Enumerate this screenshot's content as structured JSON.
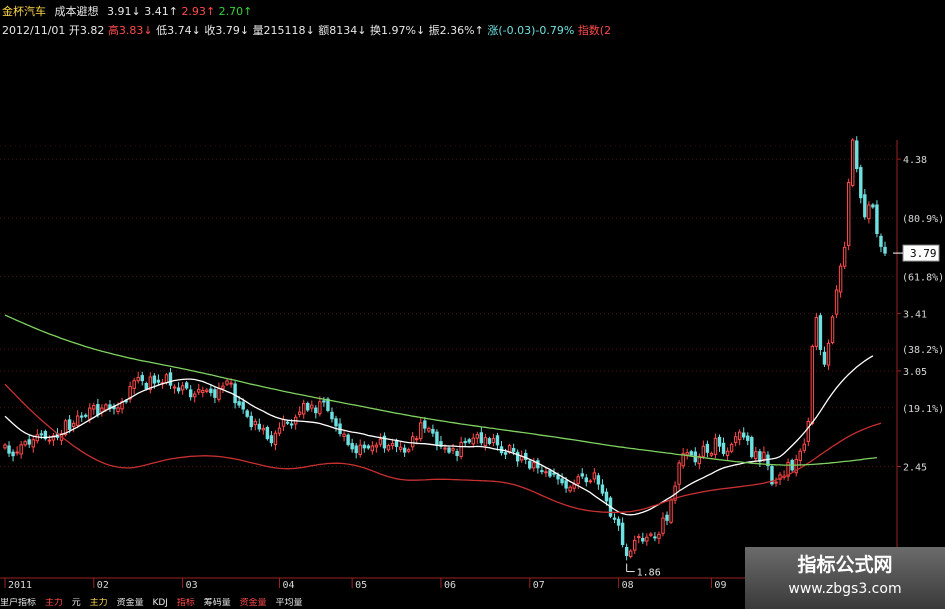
{
  "header": {
    "line1": {
      "name": "金杯汽车",
      "indicator": "成本避想",
      "v1": "3.91",
      "v2": "3.41",
      "v3": "2.93",
      "v4": "2.70"
    },
    "line2": {
      "date": "2012/11/01",
      "open": "开3.82",
      "high": "高3.83",
      "low": "低3.74",
      "close": "收3.79",
      "volume": "量215118",
      "amount": "额8134",
      "turnover": "换1.97%",
      "amplitude": "振2.36%",
      "change": "涨(-0.03)-0.79%",
      "index": "指数(2"
    }
  },
  "watermark": {
    "title": "指标公式网",
    "url": "www.zbgs3.com"
  },
  "bottom": [
    "里户指标",
    "主力",
    "元",
    "主力",
    "资金量",
    "KDJ",
    "指标",
    "筹码量",
    "资金量",
    "平均量"
  ],
  "colors": {
    "background": "#000000",
    "up": "#ff4a4a",
    "down": "#6fe0e0",
    "ma_short": "#ffffff",
    "ma_mid": "#ff7070",
    "ma_long": "#c83030",
    "ma_green": "#7fd25f",
    "axis": "#9b2222"
  },
  "chart_data": {
    "type": "line",
    "title": "",
    "xlabel": "",
    "ylabel": "",
    "ylim": [
      1.75,
      4.5
    ],
    "x_tick_labels": [
      "2011",
      "02",
      "03",
      "04",
      "05",
      "06",
      "07",
      "08",
      "09"
    ],
    "y_tick_labels": [
      "4.38",
      "3.41",
      "3.05",
      "2.45"
    ],
    "pct_labels": [
      "(80.9%)",
      "(61.8%)",
      "(38.2%)",
      "(19.1%)"
    ],
    "last_price": "3.79",
    "low_annotation": "1.86",
    "x": [
      0,
      1,
      2,
      3,
      4,
      5,
      6,
      7,
      8,
      9,
      10,
      11,
      12,
      13,
      14,
      15,
      16,
      17,
      18,
      19,
      20,
      21,
      22,
      23,
      24,
      25,
      26,
      27,
      28,
      29,
      30,
      31,
      32,
      33,
      34,
      35,
      36,
      37,
      38,
      39,
      40,
      41,
      42,
      43,
      44,
      45,
      46,
      47,
      48,
      49,
      50,
      51,
      52,
      53,
      54,
      55,
      56,
      57,
      58,
      59,
      60,
      61,
      62,
      63,
      64,
      65,
      66,
      67,
      68,
      69,
      70,
      71,
      72,
      73,
      74,
      75,
      76,
      77,
      78,
      79,
      80,
      81,
      82,
      83,
      84,
      85,
      86,
      87,
      88,
      89,
      90,
      91,
      92,
      93,
      94,
      95,
      96,
      97,
      98,
      99,
      100,
      101,
      102,
      103,
      104,
      105,
      106,
      107,
      108,
      109,
      110,
      111,
      112,
      113,
      114,
      115,
      116,
      117,
      118,
      119,
      120,
      121,
      122,
      123,
      124,
      125,
      126,
      127,
      128,
      129,
      130,
      131,
      132,
      133,
      134,
      135,
      136,
      137,
      138,
      139,
      140,
      141,
      142,
      143,
      144,
      145,
      146,
      147,
      148,
      149,
      150,
      151,
      152,
      153,
      154,
      155,
      156,
      157,
      158,
      159,
      160,
      161,
      162,
      163,
      164,
      165,
      166,
      167,
      168,
      169,
      170,
      171,
      172,
      173,
      174,
      175,
      176,
      177,
      178,
      179,
      180,
      181,
      182,
      183,
      184,
      185,
      186,
      187,
      188,
      189,
      190,
      191,
      192,
      193,
      194,
      195,
      196,
      197,
      198,
      199,
      200,
      201,
      202,
      203,
      204,
      205,
      206,
      207,
      208,
      209,
      210,
      211,
      212,
      213,
      214,
      215,
      216,
      217,
      218,
      219,
      220,
      221,
      222,
      223,
      224,
      225
    ],
    "close": [
      2.585,
      2.534,
      2.518,
      2.541,
      2.586,
      2.606,
      2.591,
      2.618,
      2.649,
      2.652,
      2.625,
      2.616,
      2.643,
      2.633,
      2.656,
      2.737,
      2.683,
      2.721,
      2.767,
      2.76,
      2.765,
      2.817,
      2.833,
      2.775,
      2.817,
      2.837,
      2.816,
      2.813,
      2.818,
      2.857,
      2.856,
      2.952,
      2.989,
      3.009,
      2.989,
      2.939,
      3.012,
      2.974,
      2.98,
      2.976,
      3.026,
      2.961,
      2.949,
      2.925,
      2.957,
      2.943,
      2.888,
      2.905,
      2.933,
      2.927,
      2.93,
      2.914,
      2.884,
      2.941,
      2.955,
      2.987,
      2.974,
      2.851,
      2.836,
      2.811,
      2.765,
      2.701,
      2.733,
      2.686,
      2.689,
      2.625,
      2.6,
      2.659,
      2.691,
      2.746,
      2.723,
      2.711,
      2.759,
      2.792,
      2.846,
      2.805,
      2.835,
      2.788,
      2.856,
      2.855,
      2.802,
      2.75,
      2.705,
      2.657,
      2.653,
      2.588,
      2.561,
      2.537,
      2.584,
      2.567,
      2.567,
      2.579,
      2.584,
      2.622,
      2.567,
      2.581,
      2.595,
      2.576,
      2.571,
      2.54,
      2.556,
      2.637,
      2.625,
      2.724,
      2.691,
      2.689,
      2.66,
      2.588,
      2.577,
      2.566,
      2.54,
      2.562,
      2.519,
      2.601,
      2.6,
      2.604,
      2.628,
      2.65,
      2.599,
      2.631,
      2.595,
      2.625,
      2.586,
      2.537,
      2.527,
      2.581,
      2.545,
      2.485,
      2.514,
      2.495,
      2.441,
      2.474,
      2.442,
      2.419,
      2.417,
      2.39,
      2.407,
      2.372,
      2.348,
      2.315,
      2.32,
      2.338,
      2.386,
      2.39,
      2.355,
      2.36,
      2.41,
      2.34,
      2.283,
      2.234,
      2.138,
      2.119,
      2.082,
      1.96,
      1.891,
      1.919,
      1.986,
      2.01,
      1.982,
      2.006,
      2.026,
      2.005,
      2.024,
      2.126,
      2.112,
      2.239,
      2.327,
      2.472,
      2.53,
      2.537,
      2.523,
      2.48,
      2.514,
      2.577,
      2.539,
      2.532,
      2.627,
      2.578,
      2.532,
      2.546,
      2.589,
      2.637,
      2.666,
      2.635,
      2.614,
      2.512,
      2.543,
      2.483,
      2.54,
      2.456,
      2.341,
      2.352,
      2.397,
      2.389,
      2.476,
      2.429,
      2.494,
      2.546,
      2.59,
      2.733,
      3.204,
      3.385,
      3.185,
      3.093,
      3.223,
      3.389,
      3.558,
      3.708,
      3.826,
      4.233,
      4.5,
      4.321,
      4.138,
      4.018,
      4.092,
      4.08,
      3.913,
      3.832,
      3.79
    ],
    "series": [
      {
        "values": [
          2.766,
          2.742,
          2.718,
          2.696,
          2.677,
          2.661,
          2.649,
          2.64,
          2.636,
          2.633,
          2.632,
          2.634,
          2.637,
          2.643,
          2.651,
          2.66,
          2.672,
          2.685,
          2.699,
          2.713,
          2.728,
          2.743,
          2.758,
          2.773,
          2.788,
          2.803,
          2.815,
          2.828,
          2.84,
          2.853,
          2.867,
          2.881,
          2.895,
          2.91,
          2.922,
          2.933,
          2.943,
          2.952,
          2.961,
          2.969,
          2.976,
          2.984,
          2.99,
          2.994,
          2.997,
          2.999,
          2.999,
          2.996,
          2.99,
          2.984,
          2.973,
          2.963,
          2.951,
          2.941,
          2.932,
          2.921,
          2.911,
          2.898,
          2.883,
          2.869,
          2.853,
          2.836,
          2.822,
          2.809,
          2.797,
          2.783,
          2.771,
          2.76,
          2.752,
          2.745,
          2.741,
          2.738,
          2.737,
          2.735,
          2.733,
          2.731,
          2.728,
          2.725,
          2.72,
          2.712,
          2.705,
          2.697,
          2.688,
          2.683,
          2.678,
          2.672,
          2.666,
          2.663,
          2.658,
          2.652,
          2.645,
          2.64,
          2.635,
          2.631,
          2.626,
          2.622,
          2.617,
          2.614,
          2.609,
          2.604,
          2.6,
          2.598,
          2.596,
          2.594,
          2.593,
          2.59,
          2.587,
          2.583,
          2.581,
          2.58,
          2.579,
          2.579,
          2.576,
          2.575,
          2.575,
          2.574,
          2.575,
          2.576,
          2.575,
          2.572,
          2.568,
          2.562,
          2.557,
          2.554,
          2.549,
          2.541,
          2.533,
          2.524,
          2.515,
          2.506,
          2.495,
          2.484,
          2.471,
          2.458,
          2.444,
          2.431,
          2.416,
          2.401,
          2.386,
          2.371,
          2.356,
          2.342,
          2.329,
          2.315,
          2.301,
          2.286,
          2.267,
          2.25,
          2.232,
          2.215,
          2.197,
          2.18,
          2.165,
          2.155,
          2.148,
          2.147,
          2.149,
          2.155,
          2.163,
          2.172,
          2.184,
          2.198,
          2.213,
          2.229,
          2.245,
          2.26,
          2.277,
          2.296,
          2.312,
          2.328,
          2.342,
          2.356,
          2.368,
          2.38,
          2.393,
          2.405,
          2.419,
          2.431,
          2.441,
          2.448,
          2.455,
          2.461,
          2.466,
          2.472,
          2.477,
          2.48,
          2.484,
          2.486,
          2.49,
          2.494,
          2.498,
          2.503,
          2.512,
          2.532,
          2.557,
          2.582,
          2.607,
          2.634,
          2.663,
          2.694,
          2.726,
          2.76,
          2.797,
          2.836,
          2.875,
          2.911,
          2.945,
          2.975,
          3.003,
          3.029,
          3.052,
          3.075,
          3.094,
          3.113,
          3.13,
          3.145
        ]
      },
      {
        "values": [
          2.967,
          2.941,
          2.914,
          2.888,
          2.862,
          2.837,
          2.812,
          2.788,
          2.765,
          2.742,
          2.72,
          2.698,
          2.677,
          2.656,
          2.636,
          2.617,
          2.598,
          2.579,
          2.562,
          2.545,
          2.529,
          2.514,
          2.5,
          2.487,
          2.476,
          2.466,
          2.457,
          2.451,
          2.446,
          2.443,
          2.441,
          2.442,
          2.444,
          2.449,
          2.454,
          2.46,
          2.467,
          2.474,
          2.48,
          2.486,
          2.492,
          2.497,
          2.501,
          2.505,
          2.508,
          2.511,
          2.514,
          2.515,
          2.516,
          2.517,
          2.517,
          2.516,
          2.515,
          2.513,
          2.51,
          2.506,
          2.502,
          2.497,
          2.492,
          2.486,
          2.48,
          2.474,
          2.468,
          2.462,
          2.456,
          2.45,
          2.445,
          2.441,
          2.438,
          2.437,
          2.436,
          2.437,
          2.439,
          2.442,
          2.445,
          2.45,
          2.455,
          2.459,
          2.463,
          2.466,
          2.469,
          2.47,
          2.471,
          2.47,
          2.468,
          2.465,
          2.461,
          2.456,
          2.449,
          2.441,
          2.432,
          2.423,
          2.413,
          2.403,
          2.394,
          2.386,
          2.379,
          2.373,
          2.369,
          2.366,
          2.364,
          2.364,
          2.364,
          2.365,
          2.366,
          2.368,
          2.369,
          2.37,
          2.37,
          2.37,
          2.369,
          2.368,
          2.367,
          2.366,
          2.365,
          2.364,
          2.363,
          2.362,
          2.361,
          2.36,
          2.359,
          2.357,
          2.355,
          2.352,
          2.348,
          2.343,
          2.337,
          2.329,
          2.321,
          2.312,
          2.301,
          2.291,
          2.28,
          2.268,
          2.257,
          2.246,
          2.235,
          2.225,
          2.216,
          2.207,
          2.199,
          2.192,
          2.185,
          2.18,
          2.175,
          2.171,
          2.168,
          2.166,
          2.164,
          2.163,
          2.162,
          2.162,
          2.162,
          2.163,
          2.165,
          2.167,
          2.171,
          2.176,
          2.182,
          2.189,
          2.197,
          2.205,
          2.214,
          2.224,
          2.233,
          2.242,
          2.25,
          2.258,
          2.265,
          2.271,
          2.277,
          2.282,
          2.287,
          2.292,
          2.296,
          2.3,
          2.304,
          2.308,
          2.311,
          2.314,
          2.317,
          2.32,
          2.323,
          2.327,
          2.33,
          2.333,
          2.337,
          2.341,
          2.346,
          2.352,
          2.358,
          2.366,
          2.376,
          2.386,
          2.397,
          2.411,
          2.426,
          2.44,
          2.456,
          2.472,
          2.488,
          2.506,
          2.524,
          2.541,
          2.558,
          2.576,
          2.592,
          2.608,
          2.624,
          2.639,
          2.652,
          2.665,
          2.676,
          2.687,
          2.697,
          2.706,
          2.714,
          2.722
        ]
      },
      {
        "values": [
          3.401,
          3.39,
          3.378,
          3.367,
          3.356,
          3.345,
          3.334,
          3.323,
          3.313,
          3.302,
          3.292,
          3.282,
          3.273,
          3.264,
          3.254,
          3.245,
          3.237,
          3.228,
          3.22,
          3.211,
          3.203,
          3.196,
          3.188,
          3.181,
          3.174,
          3.167,
          3.161,
          3.154,
          3.148,
          3.142,
          3.136,
          3.13,
          3.125,
          3.119,
          3.114,
          3.109,
          3.104,
          3.099,
          3.094,
          3.089,
          3.084,
          3.079,
          3.074,
          3.069,
          3.064,
          3.059,
          3.053,
          3.048,
          3.042,
          3.037,
          3.031,
          3.026,
          3.02,
          3.014,
          3.008,
          3.002,
          2.996,
          2.991,
          2.985,
          2.979,
          2.973,
          2.967,
          2.962,
          2.956,
          2.95,
          2.945,
          2.939,
          2.934,
          2.928,
          2.923,
          2.917,
          2.912,
          2.907,
          2.902,
          2.897,
          2.892,
          2.887,
          2.882,
          2.877,
          2.872,
          2.867,
          2.863,
          2.858,
          2.853,
          2.848,
          2.843,
          2.839,
          2.834,
          2.829,
          2.824,
          2.819,
          2.814,
          2.809,
          2.804,
          2.799,
          2.794,
          2.789,
          2.784,
          2.78,
          2.775,
          2.771,
          2.766,
          2.762,
          2.758,
          2.753,
          2.749,
          2.745,
          2.741,
          2.737,
          2.733,
          2.729,
          2.725,
          2.721,
          2.717,
          2.714,
          2.71,
          2.706,
          2.703,
          2.699,
          2.696,
          2.692,
          2.689,
          2.685,
          2.682,
          2.678,
          2.675,
          2.671,
          2.668,
          2.664,
          2.661,
          2.657,
          2.654,
          2.65,
          2.646,
          2.643,
          2.639,
          2.636,
          2.632,
          2.628,
          2.624,
          2.621,
          2.617,
          2.613,
          2.609,
          2.605,
          2.601,
          2.597,
          2.593,
          2.589,
          2.585,
          2.581,
          2.578,
          2.574,
          2.571,
          2.567,
          2.564,
          2.561,
          2.557,
          2.554,
          2.551,
          2.548,
          2.544,
          2.541,
          2.538,
          2.535,
          2.532,
          2.528,
          2.525,
          2.522,
          2.519,
          2.515,
          2.512,
          2.509,
          2.506,
          2.502,
          2.499,
          2.496,
          2.493,
          2.49,
          2.487,
          2.484,
          2.481,
          2.479,
          2.476,
          2.474,
          2.471,
          2.469,
          2.467,
          2.465,
          2.463,
          2.462,
          2.461,
          2.46,
          2.459,
          2.459,
          2.459,
          2.459,
          2.46,
          2.461,
          2.462,
          2.463,
          2.465,
          2.467,
          2.469,
          2.471,
          2.474,
          2.476,
          2.479,
          2.482,
          2.484,
          2.487,
          2.49,
          2.493,
          2.497,
          2.5,
          2.503,
          2.506
        ]
      }
    ]
  }
}
